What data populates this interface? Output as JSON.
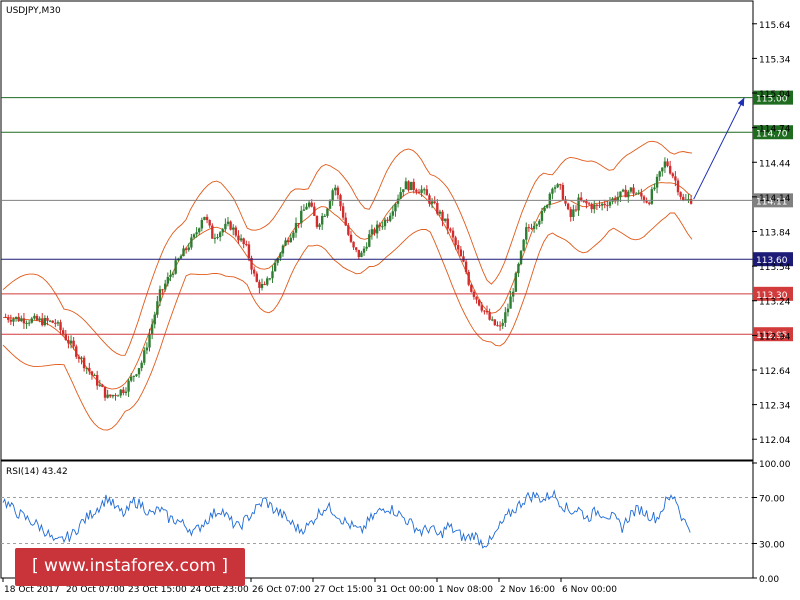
{
  "chart_data": {
    "type": "candlestick",
    "symbol": "USDJPY,M30",
    "y_ticks": [
      "115.64",
      "115.34",
      "115.04",
      "114.74",
      "114.44",
      "114.14",
      "113.84",
      "113.54",
      "113.24",
      "112.94",
      "112.64",
      "112.34",
      "112.04"
    ],
    "ylim": [
      111.86,
      115.82
    ],
    "levels": [
      {
        "label": "115.00",
        "value": 115.0,
        "color": "#1f6b1f"
      },
      {
        "label": "114.70",
        "value": 114.7,
        "color": "#1f6b1f"
      },
      {
        "label": "114.11",
        "value": 114.11,
        "color": "#808080"
      },
      {
        "label": "113.60",
        "value": 113.6,
        "color": "#1c1c78"
      },
      {
        "label": "113.30",
        "value": 113.3,
        "color": "#d13b3b"
      },
      {
        "label": "112.95",
        "value": 112.95,
        "color": "#d13b3b"
      }
    ],
    "x_labels": [
      "18 Oct 2017",
      "20 Oct 07:00",
      "23 Oct 15:00",
      "24 Oct 23:00",
      "26 Oct 07:00",
      "27 Oct 15:00",
      "31 Oct 00:00",
      "1 Nov 08:00",
      "2 Nov 16:00",
      "6 Nov 00:00"
    ],
    "close_path": [
      [
        0,
        113.1
      ],
      [
        3,
        113.05
      ],
      [
        5,
        112.62
      ],
      [
        6,
        112.4
      ],
      [
        7,
        112.48
      ],
      [
        8,
        112.72
      ],
      [
        9,
        113.3
      ],
      [
        10,
        113.58
      ],
      [
        11,
        113.8
      ],
      [
        11.5,
        114.0
      ],
      [
        12,
        113.8
      ],
      [
        13,
        113.9
      ],
      [
        14,
        113.68
      ],
      [
        14.5,
        113.4
      ],
      [
        15,
        113.35
      ],
      [
        16,
        113.7
      ],
      [
        17,
        113.95
      ],
      [
        17.5,
        114.1
      ],
      [
        18,
        113.9
      ],
      [
        18.5,
        114.02
      ],
      [
        19,
        114.25
      ],
      [
        19.5,
        113.98
      ],
      [
        20,
        113.7
      ],
      [
        20.5,
        113.62
      ],
      [
        21,
        113.8
      ],
      [
        22,
        113.95
      ],
      [
        23,
        114.25
      ],
      [
        24,
        114.2
      ],
      [
        25,
        114.0
      ],
      [
        25.5,
        113.88
      ],
      [
        26,
        113.7
      ],
      [
        26.5,
        113.52
      ],
      [
        26.8,
        113.35
      ],
      [
        27,
        113.3
      ],
      [
        28,
        113.05
      ],
      [
        28.5,
        113.0
      ],
      [
        29,
        113.2
      ],
      [
        29.5,
        113.5
      ],
      [
        30,
        113.85
      ],
      [
        31,
        114.0
      ],
      [
        31.5,
        114.25
      ],
      [
        32,
        114.2
      ],
      [
        32.5,
        113.95
      ],
      [
        33,
        114.1
      ],
      [
        34,
        114.05
      ],
      [
        35,
        114.12
      ],
      [
        36,
        114.2
      ],
      [
        37,
        114.1
      ],
      [
        38,
        114.45
      ],
      [
        38.5,
        114.3
      ],
      [
        39,
        114.1
      ],
      [
        39.5,
        114.12
      ]
    ],
    "bands_offset": 0.32,
    "current_price": 114.11,
    "arrow": {
      "from": [
        39.6,
        114.12
      ],
      "to": [
        42.5,
        115.0
      ]
    },
    "rsi": {
      "label": "RSI(14) 43.42",
      "ticks": [
        "100.00",
        "70.00",
        "30.00",
        "0.00"
      ],
      "levels": [
        70,
        30
      ],
      "series": [
        [
          0,
          68
        ],
        [
          0.7,
          58
        ],
        [
          1.3,
          52
        ],
        [
          2,
          46
        ],
        [
          2.5,
          40
        ],
        [
          3,
          30
        ],
        [
          3.5,
          34
        ],
        [
          4,
          38
        ],
        [
          4.5,
          48
        ],
        [
          5,
          55
        ],
        [
          5.5,
          62
        ],
        [
          6,
          70
        ],
        [
          6.5,
          60
        ],
        [
          7,
          55
        ],
        [
          7.5,
          67
        ],
        [
          8,
          63
        ],
        [
          8.5,
          55
        ],
        [
          9,
          60
        ],
        [
          9.5,
          52
        ],
        [
          10,
          50
        ],
        [
          10.5,
          45
        ],
        [
          11,
          40
        ],
        [
          11.5,
          48
        ],
        [
          12,
          55
        ],
        [
          12.5,
          60
        ],
        [
          13,
          50
        ],
        [
          13.5,
          44
        ],
        [
          14,
          52
        ],
        [
          14.5,
          60
        ],
        [
          15,
          68
        ],
        [
          15.5,
          60
        ],
        [
          16,
          55
        ],
        [
          16.5,
          48
        ],
        [
          17,
          42
        ],
        [
          17.5,
          45
        ],
        [
          18,
          55
        ],
        [
          18.5,
          62
        ],
        [
          19,
          58
        ],
        [
          19.5,
          50
        ],
        [
          20,
          45
        ],
        [
          20.5,
          40
        ],
        [
          21,
          50
        ],
        [
          21.5,
          57
        ],
        [
          22,
          62
        ],
        [
          22.5,
          58
        ],
        [
          23,
          52
        ],
        [
          23.5,
          46
        ],
        [
          24,
          40
        ],
        [
          24.5,
          44
        ],
        [
          25,
          36
        ],
        [
          25.5,
          45
        ],
        [
          26,
          40
        ],
        [
          26.5,
          34
        ],
        [
          27,
          38
        ],
        [
          27.5,
          30
        ],
        [
          28,
          32
        ],
        [
          28.5,
          45
        ],
        [
          29,
          55
        ],
        [
          29.5,
          62
        ],
        [
          30,
          70
        ],
        [
          30.5,
          72
        ],
        [
          31,
          68
        ],
        [
          31.5,
          74
        ],
        [
          32,
          65
        ],
        [
          32.5,
          58
        ],
        [
          33,
          60
        ],
        [
          33.5,
          52
        ],
        [
          34,
          58
        ],
        [
          34.5,
          56
        ],
        [
          35,
          52
        ],
        [
          35.5,
          44
        ],
        [
          36,
          56
        ],
        [
          36.5,
          60
        ],
        [
          37,
          55
        ],
        [
          37.5,
          52
        ],
        [
          38,
          66
        ],
        [
          38.5,
          72
        ],
        [
          39,
          50
        ],
        [
          39.5,
          43
        ]
      ]
    },
    "colors": {
      "bull": "#2e7d32",
      "bear": "#d22c2c",
      "band": "#e05a1a",
      "arrow": "#1f2fb4",
      "rsi_line": "#1f6bd6",
      "axis": "#000000"
    }
  },
  "watermark": "[ www.instaforex.com ]"
}
